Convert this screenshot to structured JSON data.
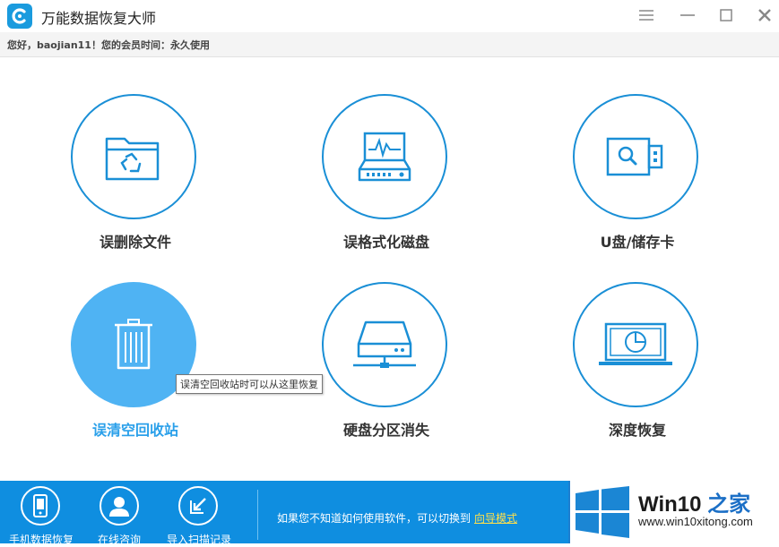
{
  "window": {
    "title": "万能数据恢复大师",
    "greeting": "您好，baojian11！您的会员时间：永久使用"
  },
  "tiles": [
    {
      "label": "误删除文件"
    },
    {
      "label": "误格式化磁盘"
    },
    {
      "label": "U盘/储存卡"
    },
    {
      "label": "误清空回收站",
      "active": true
    },
    {
      "label": "硬盘分区消失"
    },
    {
      "label": "深度恢复"
    }
  ],
  "tooltip": "误清空回收站时可以从这里恢复",
  "bottom": {
    "buttons": [
      {
        "label": "手机数据恢复"
      },
      {
        "label": "在线咨询"
      },
      {
        "label": "导入扫描记录"
      }
    ],
    "hint": "如果您不知道如何使用软件，可以切换到",
    "guide_link": "向导模式"
  },
  "watermark": {
    "brand_prefix": "Win10 ",
    "brand_suffix": "之家",
    "url": "www.win10xitong.com"
  },
  "colors": {
    "accent": "#1a8fd6",
    "active_tile": "#4fb3f3",
    "bottom_bar": "#0f8ee0",
    "link": "#ffe04a"
  },
  "icons": {
    "app": "recovery-logo-icon",
    "tiles": [
      "folder-recycle-icon",
      "hard-disk-monitor-icon",
      "usb-drive-icon",
      "trash-bin-icon",
      "network-drive-icon",
      "laptop-icon"
    ],
    "bottom": [
      "phone-icon",
      "user-icon",
      "import-icon"
    ]
  }
}
